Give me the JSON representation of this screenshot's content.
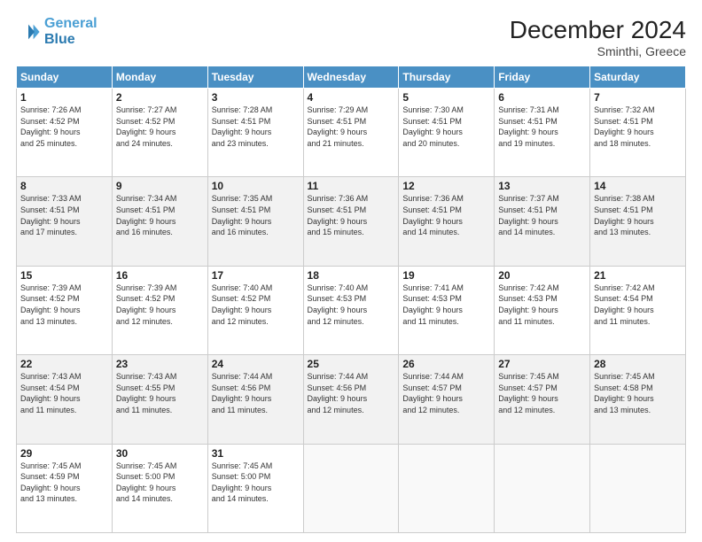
{
  "logo": {
    "line1": "General",
    "line2": "Blue"
  },
  "title": "December 2024",
  "location": "Sminthi, Greece",
  "days_of_week": [
    "Sunday",
    "Monday",
    "Tuesday",
    "Wednesday",
    "Thursday",
    "Friday",
    "Saturday"
  ],
  "weeks": [
    [
      {
        "day": "1",
        "sunrise": "7:26 AM",
        "sunset": "4:52 PM",
        "daylight": "9 hours and 25 minutes."
      },
      {
        "day": "2",
        "sunrise": "7:27 AM",
        "sunset": "4:52 PM",
        "daylight": "9 hours and 24 minutes."
      },
      {
        "day": "3",
        "sunrise": "7:28 AM",
        "sunset": "4:51 PM",
        "daylight": "9 hours and 23 minutes."
      },
      {
        "day": "4",
        "sunrise": "7:29 AM",
        "sunset": "4:51 PM",
        "daylight": "9 hours and 21 minutes."
      },
      {
        "day": "5",
        "sunrise": "7:30 AM",
        "sunset": "4:51 PM",
        "daylight": "9 hours and 20 minutes."
      },
      {
        "day": "6",
        "sunrise": "7:31 AM",
        "sunset": "4:51 PM",
        "daylight": "9 hours and 19 minutes."
      },
      {
        "day": "7",
        "sunrise": "7:32 AM",
        "sunset": "4:51 PM",
        "daylight": "9 hours and 18 minutes."
      }
    ],
    [
      {
        "day": "8",
        "sunrise": "7:33 AM",
        "sunset": "4:51 PM",
        "daylight": "9 hours and 17 minutes."
      },
      {
        "day": "9",
        "sunrise": "7:34 AM",
        "sunset": "4:51 PM",
        "daylight": "9 hours and 16 minutes."
      },
      {
        "day": "10",
        "sunrise": "7:35 AM",
        "sunset": "4:51 PM",
        "daylight": "9 hours and 16 minutes."
      },
      {
        "day": "11",
        "sunrise": "7:36 AM",
        "sunset": "4:51 PM",
        "daylight": "9 hours and 15 minutes."
      },
      {
        "day": "12",
        "sunrise": "7:36 AM",
        "sunset": "4:51 PM",
        "daylight": "9 hours and 14 minutes."
      },
      {
        "day": "13",
        "sunrise": "7:37 AM",
        "sunset": "4:51 PM",
        "daylight": "9 hours and 14 minutes."
      },
      {
        "day": "14",
        "sunrise": "7:38 AM",
        "sunset": "4:51 PM",
        "daylight": "9 hours and 13 minutes."
      }
    ],
    [
      {
        "day": "15",
        "sunrise": "7:39 AM",
        "sunset": "4:52 PM",
        "daylight": "9 hours and 13 minutes."
      },
      {
        "day": "16",
        "sunrise": "7:39 AM",
        "sunset": "4:52 PM",
        "daylight": "9 hours and 12 minutes."
      },
      {
        "day": "17",
        "sunrise": "7:40 AM",
        "sunset": "4:52 PM",
        "daylight": "9 hours and 12 minutes."
      },
      {
        "day": "18",
        "sunrise": "7:40 AM",
        "sunset": "4:53 PM",
        "daylight": "9 hours and 12 minutes."
      },
      {
        "day": "19",
        "sunrise": "7:41 AM",
        "sunset": "4:53 PM",
        "daylight": "9 hours and 11 minutes."
      },
      {
        "day": "20",
        "sunrise": "7:42 AM",
        "sunset": "4:53 PM",
        "daylight": "9 hours and 11 minutes."
      },
      {
        "day": "21",
        "sunrise": "7:42 AM",
        "sunset": "4:54 PM",
        "daylight": "9 hours and 11 minutes."
      }
    ],
    [
      {
        "day": "22",
        "sunrise": "7:43 AM",
        "sunset": "4:54 PM",
        "daylight": "9 hours and 11 minutes."
      },
      {
        "day": "23",
        "sunrise": "7:43 AM",
        "sunset": "4:55 PM",
        "daylight": "9 hours and 11 minutes."
      },
      {
        "day": "24",
        "sunrise": "7:44 AM",
        "sunset": "4:56 PM",
        "daylight": "9 hours and 11 minutes."
      },
      {
        "day": "25",
        "sunrise": "7:44 AM",
        "sunset": "4:56 PM",
        "daylight": "9 hours and 12 minutes."
      },
      {
        "day": "26",
        "sunrise": "7:44 AM",
        "sunset": "4:57 PM",
        "daylight": "9 hours and 12 minutes."
      },
      {
        "day": "27",
        "sunrise": "7:45 AM",
        "sunset": "4:57 PM",
        "daylight": "9 hours and 12 minutes."
      },
      {
        "day": "28",
        "sunrise": "7:45 AM",
        "sunset": "4:58 PM",
        "daylight": "9 hours and 13 minutes."
      }
    ],
    [
      {
        "day": "29",
        "sunrise": "7:45 AM",
        "sunset": "4:59 PM",
        "daylight": "9 hours and 13 minutes."
      },
      {
        "day": "30",
        "sunrise": "7:45 AM",
        "sunset": "5:00 PM",
        "daylight": "9 hours and 14 minutes."
      },
      {
        "day": "31",
        "sunrise": "7:45 AM",
        "sunset": "5:00 PM",
        "daylight": "9 hours and 14 minutes."
      },
      null,
      null,
      null,
      null
    ]
  ],
  "labels": {
    "sunrise": "Sunrise:",
    "sunset": "Sunset:",
    "daylight": "Daylight:"
  }
}
